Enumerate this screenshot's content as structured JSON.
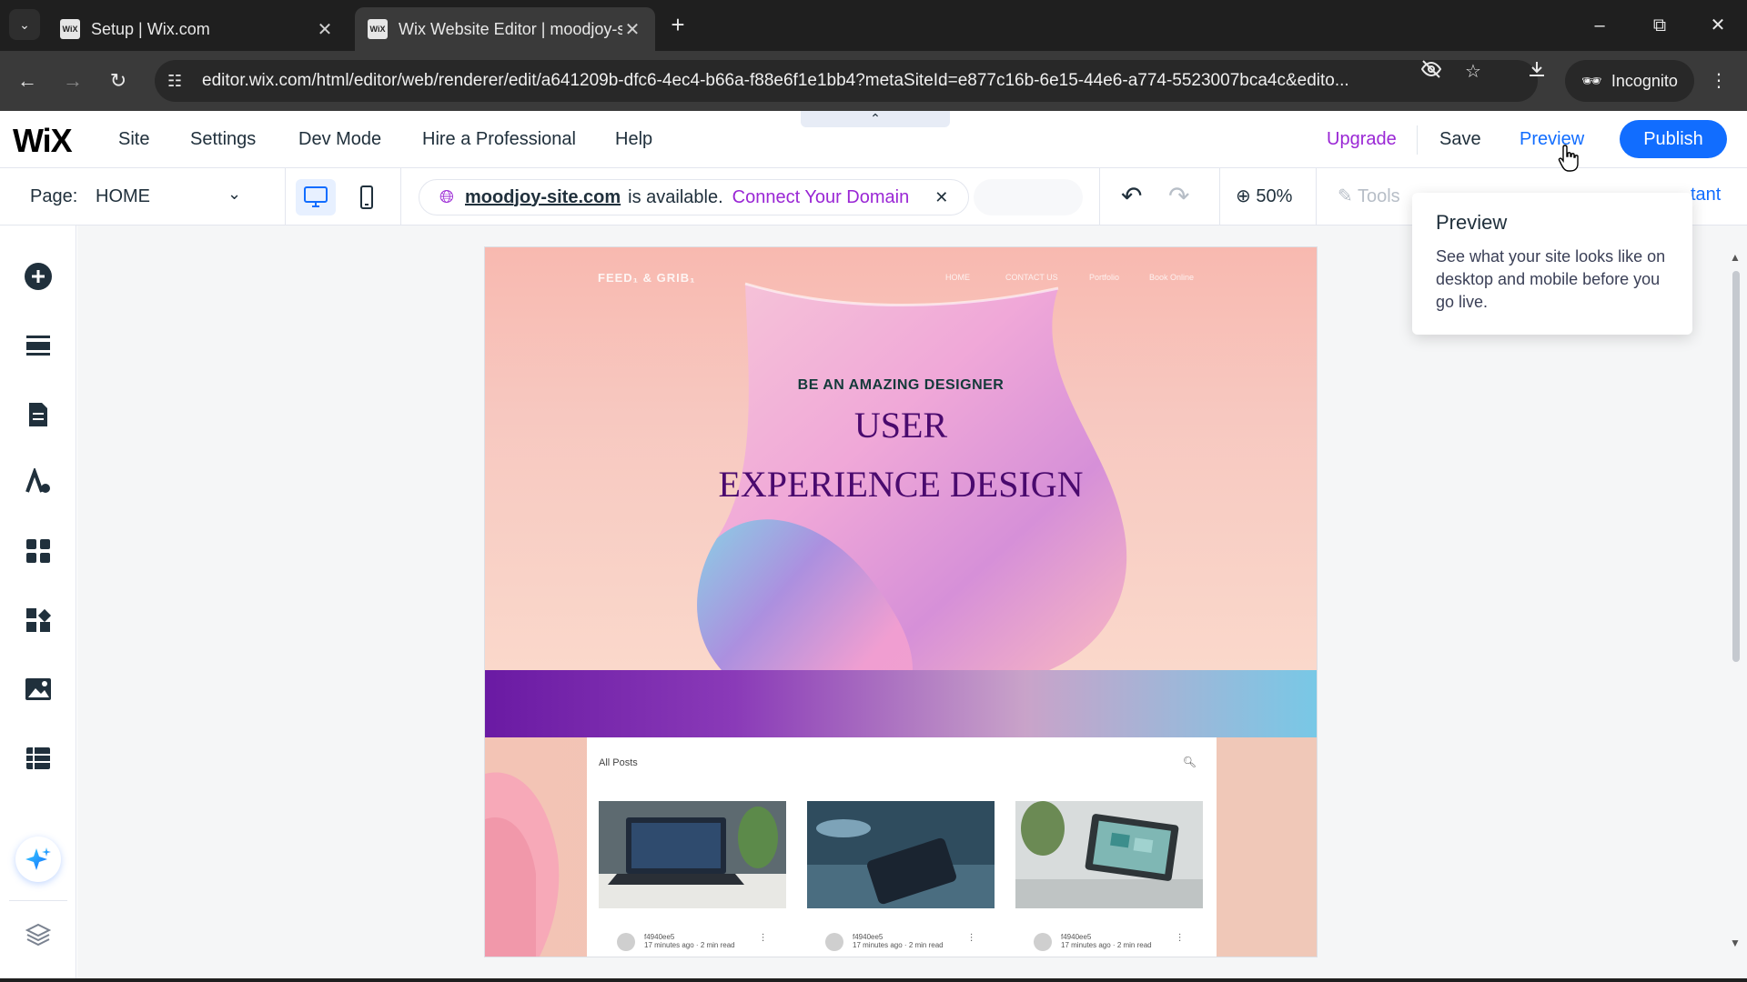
{
  "browser": {
    "tabs": [
      {
        "title": "Setup | Wix.com",
        "favicon": "WiX"
      },
      {
        "title": "Wix Website Editor | moodjoy-s",
        "favicon": "WiX"
      }
    ],
    "url": "editor.wix.com/html/editor/web/renderer/edit/a641209b-dfc6-4ec4-b66a-f88e6f1e1bb4?metaSiteId=e877c16b-6e15-44e6-a774-5523007bca4c&edito...",
    "incognito_label": "Incognito"
  },
  "wix": {
    "logo": "WiX",
    "menu": [
      "Site",
      "Settings",
      "Dev Mode",
      "Hire a Professional",
      "Help"
    ],
    "upgrade": "Upgrade",
    "save": "Save",
    "preview": "Preview",
    "publish": "Publish",
    "page_label": "Page:",
    "page_value": "HOME",
    "domain": {
      "name": "moodjoy-site.com",
      "available_text": "is available.",
      "connect": "Connect Your Domain"
    },
    "zoom": "50%",
    "tools": "Tools",
    "assistant_partial": "tant"
  },
  "tooltip": {
    "title": "Preview",
    "body": "See what your site looks like on desktop and mobile before you go live."
  },
  "site": {
    "brand": "FEED₁ & GRIB₁",
    "nav": [
      "HOME",
      "CONTACT US",
      "Portfolio",
      "Book Online"
    ],
    "kicker": "BE AN AMAZING DESIGNER",
    "title_line1": "USER",
    "title_line2": "EXPERIENCE DESIGN",
    "blog_heading": "All Posts",
    "posts": [
      {
        "author": "f4940ee5",
        "time": "17 minutes ago · 2 min read"
      },
      {
        "author": "f4940ee5",
        "time": "17 minutes ago · 2 min read"
      },
      {
        "author": "f4940ee5",
        "time": "17 minutes ago · 2 min read"
      }
    ]
  },
  "colors": {
    "accent": "#116dff",
    "upgrade": "#9a27d5",
    "hero_title": "#4a0a6e"
  }
}
